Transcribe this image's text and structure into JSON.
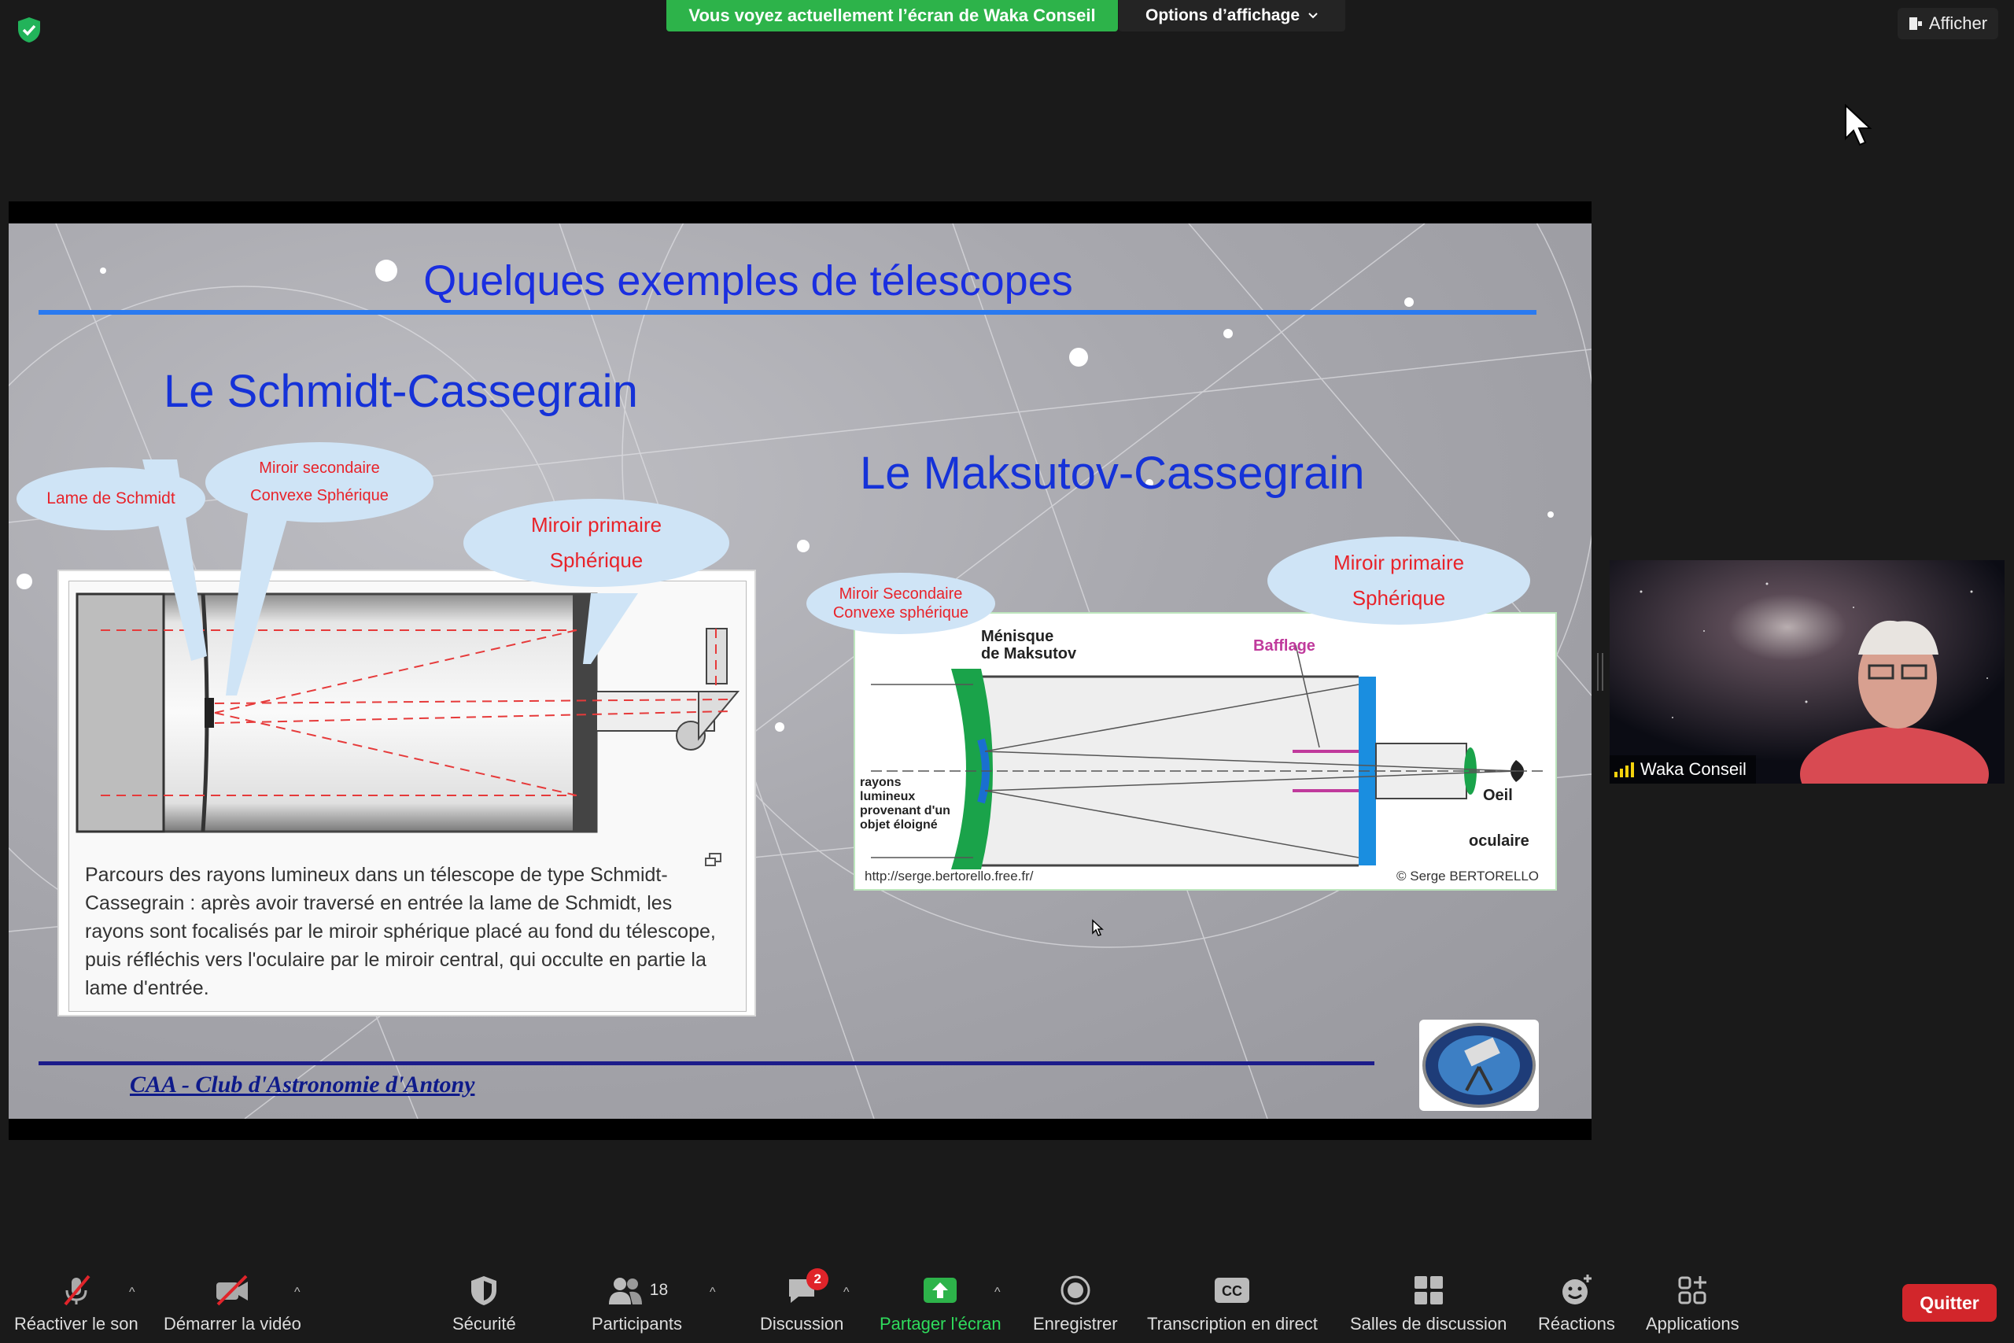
{
  "top": {
    "share_banner": "Vous voyez actuellement l’écran de Waka Conseil",
    "view_options": "Options d’affichage",
    "afficher": "Afficher"
  },
  "slide": {
    "title": "Quelques exemples de télescopes",
    "schmidt": {
      "title": "Le Schmidt-Cassegrain",
      "bubble_lame": "Lame de Schmidt",
      "bubble_secondaire_1": "Miroir secondaire",
      "bubble_secondaire_2": "Convexe Sphérique",
      "bubble_primaire_1": "Miroir primaire",
      "bubble_primaire_2": "Sphérique",
      "caption": "Parcours des rayons lumineux dans un télescope de type Schmidt-Cassegrain : après avoir traversé en entrée la lame de Schmidt, les rayons sont focalisés par le miroir sphérique placé au fond du télescope, puis réfléchis vers l'oculaire par le miroir central, qui occulte en partie la lame d'entrée."
    },
    "maksutov": {
      "title": "Le Maksutov-Cassegrain",
      "bubble_secondaire_1": "Miroir Secondaire",
      "bubble_secondaire_2": "Convexe sphérique",
      "bubble_primaire_1": "Miroir primaire",
      "bubble_primaire_2": "Sphérique",
      "menisque_1": "Ménisque",
      "menisque_2": "de Maksutov",
      "bafflage": "Bafflage",
      "rayons_1": "rayons",
      "rayons_2": "lumineux",
      "rayons_3": "provenant d'un",
      "rayons_4": "objet éloigné",
      "oeil": "Oeil",
      "oculaire": "oculaire",
      "url": "http://serge.bertorello.free.fr/",
      "copyright": "© Serge BERTORELLO"
    },
    "footer": "CAA - Club d'Astronomie d'Antony"
  },
  "participant": {
    "name": "Waka Conseil"
  },
  "toolbar": {
    "unmute": "Réactiver le son",
    "start_video": "Démarrer la vidéo",
    "security": "Sécurité",
    "participants": "Participants",
    "participants_count": "18",
    "chat": "Discussion",
    "chat_badge": "2",
    "share": "Partager l'écran",
    "record": "Enregistrer",
    "cc_glyph": "CC",
    "transcription": "Transcription en direct",
    "rooms": "Salles de discussion",
    "reactions": "Réactions",
    "apps": "Applications",
    "quit": "Quitter"
  },
  "colors": {
    "accent_green": "#2db34a",
    "quit_red": "#d2262b",
    "slide_blue": "#1532d8"
  },
  "icons": [
    "shield-check-icon",
    "chevron-down-icon",
    "pin-icon",
    "mic-off-icon",
    "video-off-icon",
    "security-shield-icon",
    "participants-icon",
    "chat-icon",
    "share-screen-icon",
    "record-icon",
    "cc-icon",
    "breakout-rooms-icon",
    "reactions-icon",
    "apps-icon"
  ]
}
